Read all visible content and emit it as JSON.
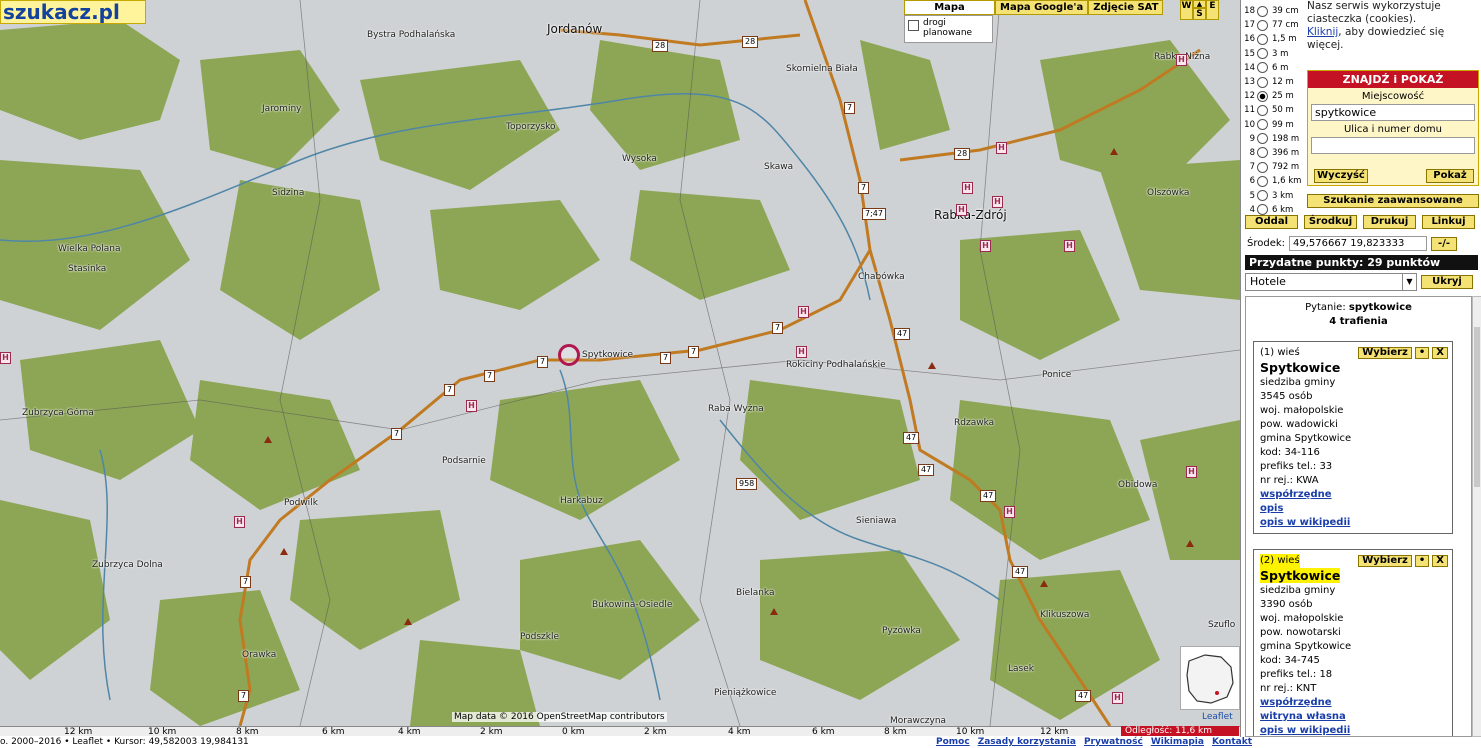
{
  "logo": {
    "text": "szukacz.pl"
  },
  "map_toolbar": {
    "mapa": "Mapa",
    "mapa_google": "Mapa Google'a",
    "zdjecie_sat": "Zdjęcie SAT",
    "roads_label": "drogi planowane",
    "w": "W",
    "s": "S",
    "e": "E"
  },
  "places": {
    "jordanow": "Jordanów",
    "bystra": "Bystra Podhalańska",
    "skomielna": "Skomielna Biała",
    "rabka_niz": "Rabka-Niżna",
    "jaworniny": "Jarominy",
    "toporzysko": "Toporzysko",
    "wysoka": "Wysoka",
    "skawa": "Skawa",
    "olszowka": "Olszówka",
    "sidzina": "Sidzina",
    "rabka_zdroj": "Rabka-Zdrój",
    "wielka_polana": "Wielka Polana",
    "stasinka": "Stasinka",
    "chabowka": "Chabówka",
    "spytkowice": "Spytkowice",
    "rokiciny": "Rokiciny Podhalańskie",
    "ponice": "Ponice",
    "zubrzyca_gorna": "Zubrzyca Górna",
    "raba_wyzna": "Raba Wyżna",
    "rdzawka": "Rdzawka",
    "podsarnie": "Podsarnie",
    "obidowa": "Obidowa",
    "podwilk": "Podwilk",
    "harkabuz": "Harkabuz",
    "sieniawa": "Sieniawa",
    "zubrzyca_dolna": "Zubrzyca Dolna",
    "bielanka": "Bielanka",
    "bukowina": "Bukowina-Osiedle",
    "klikuszowa": "Klikuszowa",
    "podszkle": "Podszkle",
    "pyzowka": "Pyzówka",
    "szuflo": "Szuflo",
    "orawka": "Orawka",
    "lasek": "Lasek",
    "pieniazkowice": "Pieniążkowice",
    "morawczyna": "Morawczyna"
  },
  "roads": {
    "r28": "28",
    "r7": "7",
    "r47": "47",
    "r747": "7;47",
    "r958": "958"
  },
  "hotel_icon": "H",
  "attribution": {
    "osm": "Map data © 2016 OpenStreetMap contributors",
    "leaflet": "Leaflet"
  },
  "scale": {
    "ticks": [
      "12 km",
      "10 km",
      "8 km",
      "6 km",
      "4 km",
      "2 km",
      "0 km",
      "2 km",
      "4 km",
      "6 km",
      "8 km",
      "10 km",
      "12 km"
    ],
    "left_ticks": [
      "12 km",
      "10 km",
      "8 km",
      "6 km",
      "4 km",
      "2 km",
      "0 km"
    ],
    "right_ticks": [
      "2 km",
      "4 km",
      "6 km",
      "8 km",
      "10 km",
      "12 km"
    ],
    "distance": "Odległość: 11,6 km"
  },
  "footer": {
    "cursor": "o. 2000–2016 • Leaflet • Kursor: 49,582003 19,984131",
    "links": [
      "Pomoc",
      "Zasady korzystania",
      "Prywatność",
      "Wikimapia",
      "Kontakt"
    ]
  },
  "cookie": {
    "line1": "Nasz serwis wykorzystuje",
    "line2": "ciasteczka (cookies).",
    "link": "Kliknij",
    "line3": ", aby dowiedzieć się",
    "line4": "więcej."
  },
  "zoom_levels": [
    {
      "lvl": "18",
      "dist": "39 cm"
    },
    {
      "lvl": "17",
      "dist": "77 cm"
    },
    {
      "lvl": "16",
      "dist": "1,5 m"
    },
    {
      "lvl": "15",
      "dist": "3 m"
    },
    {
      "lvl": "14",
      "dist": "6 m"
    },
    {
      "lvl": "13",
      "dist": "12 m"
    },
    {
      "lvl": "12",
      "dist": "25 m"
    },
    {
      "lvl": "11",
      "dist": "50 m"
    },
    {
      "lvl": "10",
      "dist": "99 m"
    },
    {
      "lvl": "9",
      "dist": "198 m"
    },
    {
      "lvl": "8",
      "dist": "396 m"
    },
    {
      "lvl": "7",
      "dist": "792 m"
    },
    {
      "lvl": "6",
      "dist": "1,6 km"
    },
    {
      "lvl": "5",
      "dist": "3 km"
    },
    {
      "lvl": "4",
      "dist": "6 km"
    }
  ],
  "zoom_selected": "12",
  "search": {
    "header": "ZNAJDŹ i POKAŻ",
    "city_label": "Miejscowość",
    "city_value": "spytkowice",
    "street_label": "Ulica i numer domu",
    "street_value": "",
    "clear": "Wyczyść",
    "show": "Pokaż",
    "advanced": "Szukanie zaawansowane"
  },
  "nav": {
    "zoom_out": "Oddal",
    "center": "Środkuj",
    "print": "Drukuj",
    "link": "Linkuj"
  },
  "center": {
    "label": "Środek:",
    "value": "49,576667 19,823333",
    "swap": "-/-"
  },
  "points": {
    "header": "Przydatne punkty: 29 punktów",
    "category": "Hotele",
    "hide": "Ukryj"
  },
  "results": {
    "query_label": "Pytanie:",
    "query_value": "spytkowice",
    "hits": "4 trafienia",
    "select": "Wybierz",
    "dot": "•",
    "close": "X",
    "items": [
      {
        "head": "(1) wieś",
        "name": "Spytkowice",
        "lines": [
          "siedziba gminy",
          "3545 osób",
          "woj. małopolskie",
          "pow. wadowicki",
          "gmina Spytkowice",
          "kod: 34-116",
          "prefiks tel.: 33",
          "nr rej.: KWA"
        ],
        "links": [
          "współrzędne",
          "opis",
          "opis w wikipedii"
        ]
      },
      {
        "head": "(2) wieś",
        "name": "Spytkowice",
        "lines": [
          "siedziba gminy",
          "3390 osób",
          "woj. małopolskie",
          "pow. nowotarski",
          "gmina Spytkowice",
          "kod: 34-745",
          "prefiks tel.: 18",
          "nr rej.: KNT"
        ],
        "links": [
          "współrzędne",
          "witryna własna",
          "opis w wikipedii"
        ]
      }
    ]
  },
  "colors": {
    "forest": "#8da655",
    "open": "#cfd2d4",
    "road_main": "#c07a22",
    "water": "#4f86a8",
    "accent_red": "#c41224",
    "button_yellow": "#f4e274"
  }
}
